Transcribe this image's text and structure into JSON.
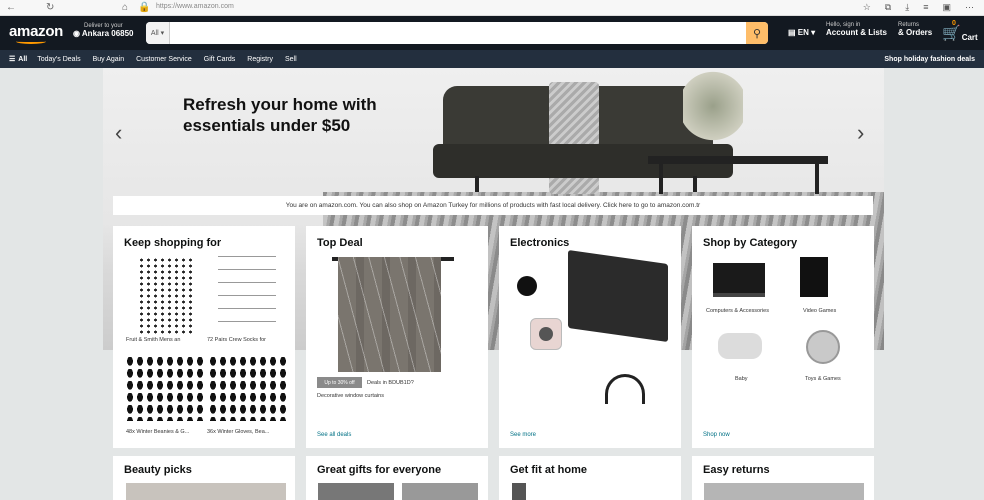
{
  "browser": {
    "url": "https://www.amazon.com"
  },
  "header": {
    "logo": "amazon",
    "deliver_line1": "Deliver to your",
    "deliver_line2": "Ankara 06850",
    "search_category": "All",
    "search_placeholder": "",
    "language": "EN",
    "account_line1": "Hello, sign in",
    "account_line2": "Account & Lists",
    "orders_line1": "Returns",
    "orders_line2": "& Orders",
    "cart_count": "0",
    "cart_label": "Cart"
  },
  "subnav": {
    "all": "All",
    "items": [
      "Today's Deals",
      "Buy Again",
      "Customer Service",
      "Gift Cards",
      "Registry",
      "Sell"
    ],
    "promo": "Shop holiday fashion deals"
  },
  "hero": {
    "title": "Refresh your home with essentials under $50"
  },
  "notice": "You are on amazon.com. You can also shop on Amazon Turkey for millions of products with fast local delivery. Click here to go to amazon.com.tr",
  "cards": {
    "keep_shopping": {
      "title": "Keep shopping for",
      "captions": [
        "Fruit & Smith Mens an",
        "72 Pairs Crew Socks for",
        "48x Winter Beanies & G...",
        "36x Winter Gloves, Bea..."
      ]
    },
    "top_deal": {
      "title": "Top Deal",
      "badge": "Up to 30% off",
      "badge_text": "Deals in BDUB1D?",
      "caption": "Decorative window curtains",
      "link": "See all deals"
    },
    "electronics": {
      "title": "Electronics",
      "link": "See more"
    },
    "shop_by_category": {
      "title": "Shop by Category",
      "items": [
        "Computers & Accessories",
        "Video Games",
        "Baby",
        "Toys & Games"
      ],
      "link": "Shop now"
    }
  },
  "bottom_cards": [
    "Beauty picks",
    "Great gifts for everyone",
    "Get fit at home",
    "Easy returns"
  ]
}
